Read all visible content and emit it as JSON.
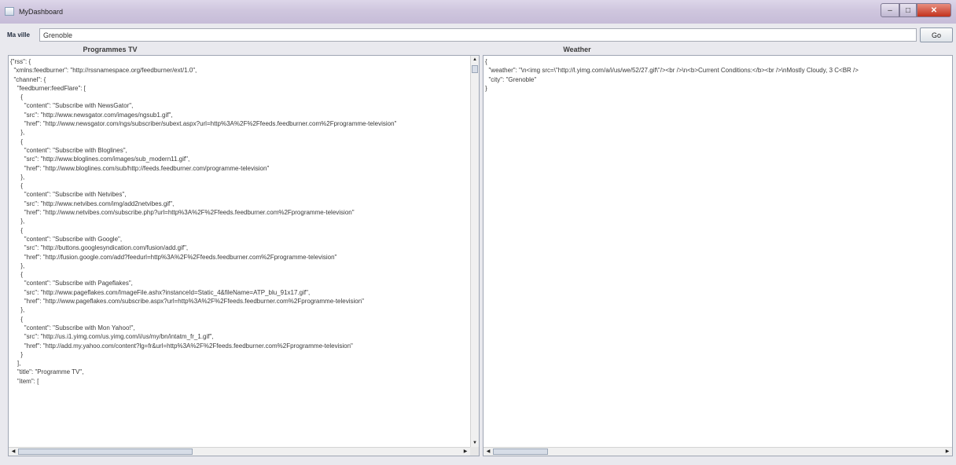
{
  "window": {
    "title": "MyDashboard",
    "minimize_glyph": "–",
    "maximize_glyph": "□",
    "close_glyph": "✕"
  },
  "city": {
    "label": "Ma ville",
    "value": "Grenoble",
    "go_label": "Go"
  },
  "tv_panel": {
    "header": "Programmes TV",
    "lines": [
      "{\"rss\": {",
      "  \"xmlns:feedburner\": \"http://rssnamespace.org/feedburner/ext/1.0\",",
      "  \"channel\": {",
      "    \"feedburner:feedFlare\": [",
      "      {",
      "        \"content\": \"Subscribe with NewsGator\",",
      "        \"src\": \"http://www.newsgator.com/images/ngsub1.gif\",",
      "        \"href\": \"http://www.newsgator.com/ngs/subscriber/subext.aspx?url=http%3A%2F%2Ffeeds.feedburner.com%2Fprogramme-television\"",
      "      },",
      "      {",
      "        \"content\": \"Subscribe with Bloglines\",",
      "        \"src\": \"http://www.bloglines.com/images/sub_modern11.gif\",",
      "        \"href\": \"http://www.bloglines.com/sub/http://feeds.feedburner.com/programme-television\"",
      "      },",
      "      {",
      "        \"content\": \"Subscribe with Netvibes\",",
      "        \"src\": \"http://www.netvibes.com/img/add2netvibes.gif\",",
      "        \"href\": \"http://www.netvibes.com/subscribe.php?url=http%3A%2F%2Ffeeds.feedburner.com%2Fprogramme-television\"",
      "      },",
      "      {",
      "        \"content\": \"Subscribe with Google\",",
      "        \"src\": \"http://buttons.googlesyndication.com/fusion/add.gif\",",
      "        \"href\": \"http://fusion.google.com/add?feedurl=http%3A%2F%2Ffeeds.feedburner.com%2Fprogramme-television\"",
      "      },",
      "      {",
      "        \"content\": \"Subscribe with Pageflakes\",",
      "        \"src\": \"http://www.pageflakes.com/ImageFile.ashx?instanceId=Static_4&fileName=ATP_blu_91x17.gif\",",
      "        \"href\": \"http://www.pageflakes.com/subscribe.aspx?url=http%3A%2F%2Ffeeds.feedburner.com%2Fprogramme-television\"",
      "      },",
      "      {",
      "        \"content\": \"Subscribe with Mon Yahoo!\",",
      "        \"src\": \"http://us.i1.yimg.com/us.yimg.com/i/us/my/bn/intatm_fr_1.gif\",",
      "        \"href\": \"http://add.my.yahoo.com/content?lg=fr&url=http%3A%2F%2Ffeeds.feedburner.com%2Fprogramme-television\"",
      "      }",
      "    ],",
      "    \"title\": \"Programme TV\",",
      "    \"item\": ["
    ]
  },
  "weather_panel": {
    "header": "Weather",
    "lines": [
      "{",
      "  \"weather\": \"\\n<img src=\\\"http://l.yimg.com/a/i/us/we/52/27.gif\\\"/><br />\\n<b>Current Conditions:</b><br />\\nMostly Cloudy, 3 C<BR />",
      "  \"city\": \"Grenoble\"",
      "}"
    ]
  },
  "scroll_glyphs": {
    "up": "▲",
    "down": "▼",
    "left": "◀",
    "right": "▶"
  }
}
